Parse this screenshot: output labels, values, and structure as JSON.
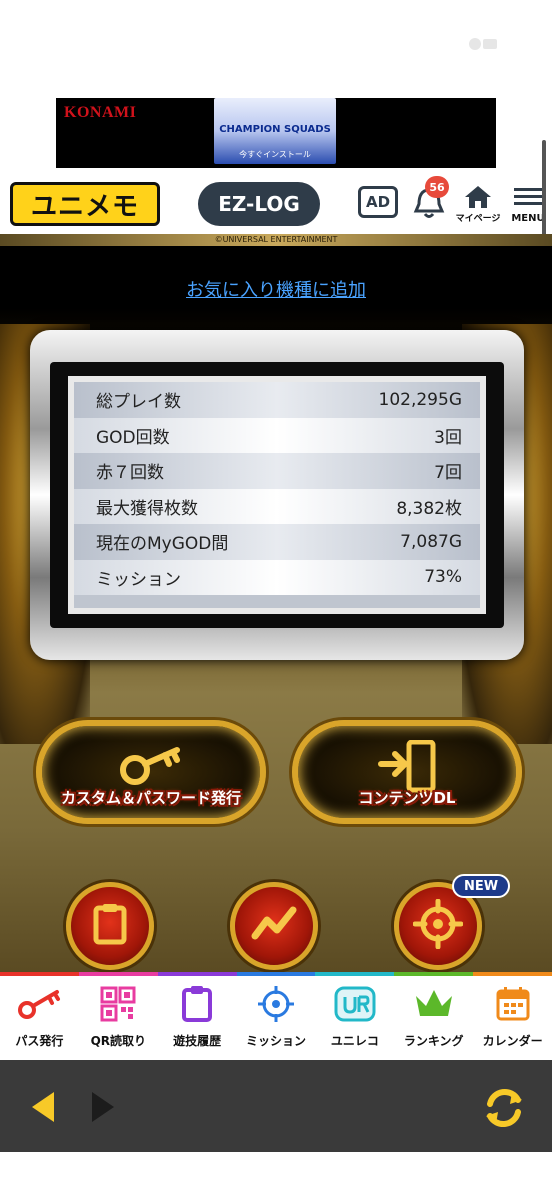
{
  "status": {
    "icon": "battery-icon"
  },
  "ad": {
    "brand": "KONAMI",
    "image_title": "CHAMPION SQUADS",
    "image_sub": "今すぐインストール"
  },
  "header": {
    "logo": "ユニメモ",
    "ezlog": "EZ-LOG",
    "ad_button": "AD",
    "notification_count": "56",
    "mypage_label": "マイページ",
    "menu_label": "MENU"
  },
  "game": {
    "copyright": "©UNIVERSAL ENTERTAINMENT",
    "favorite_link": "お気に入り機種に追加",
    "stats": [
      {
        "label": "総プレイ数",
        "value": "102,295G"
      },
      {
        "label": "GOD回数",
        "value": "3回"
      },
      {
        "label": "赤７回数",
        "value": "7回"
      },
      {
        "label": "最大獲得枚数",
        "value": "8,382枚"
      },
      {
        "label": "現在のMyGOD間",
        "value": "7,087G"
      },
      {
        "label": "ミッション",
        "value": "73%"
      }
    ],
    "buttons": {
      "custom_password": "カスタム＆パスワード発行",
      "contents_dl": "コンテンツDL"
    },
    "new_badge": "NEW"
  },
  "tabs": [
    {
      "label": "パス発行",
      "icon": "key-icon",
      "color": "#e8322a"
    },
    {
      "label": "QR読取り",
      "icon": "qr-icon",
      "color": "#e83ca0"
    },
    {
      "label": "遊技履歴",
      "icon": "clipboard-icon",
      "color": "#8a3ad8"
    },
    {
      "label": "ミッション",
      "icon": "target-icon",
      "color": "#2a7ae0"
    },
    {
      "label": "ユニレコ",
      "icon": "unireco-icon",
      "color": "#22b8c8"
    },
    {
      "label": "ランキング",
      "icon": "crown-icon",
      "color": "#5cb82a"
    },
    {
      "label": "カレンダー",
      "icon": "calendar-icon",
      "color": "#f08a1a"
    }
  ]
}
